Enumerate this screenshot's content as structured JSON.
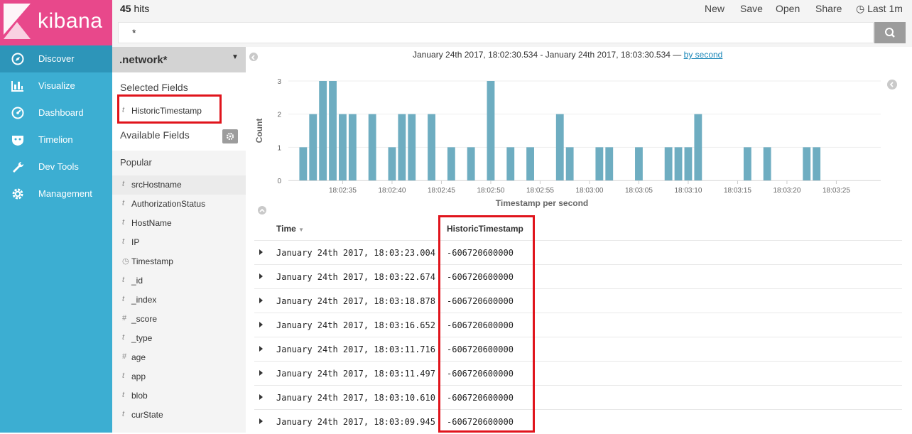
{
  "app": {
    "logo_text": "kibana",
    "brand_color": "#e8488b",
    "nav_color": "#3caed2"
  },
  "nav": {
    "items": [
      {
        "label": "Discover",
        "icon": "compass-icon",
        "active": true
      },
      {
        "label": "Visualize",
        "icon": "bar-chart-icon",
        "active": false
      },
      {
        "label": "Dashboard",
        "icon": "dashboard-gauge-icon",
        "active": false
      },
      {
        "label": "Timelion",
        "icon": "timelion-shield-icon",
        "active": false
      },
      {
        "label": "Dev Tools",
        "icon": "wrench-icon",
        "active": false
      },
      {
        "label": "Management",
        "icon": "gear-icon",
        "active": false
      }
    ]
  },
  "topbar": {
    "hits_count": "45",
    "hits_label": "hits",
    "actions": [
      "New",
      "Save",
      "Open",
      "Share"
    ],
    "time_picker": "Last 1m",
    "query": "*"
  },
  "sidebar": {
    "index_pattern": ".network*",
    "selected_title": "Selected Fields",
    "selected_fields": [
      {
        "type": "t",
        "name": "HistoricTimestamp"
      }
    ],
    "available_title": "Available Fields",
    "popular_title": "Popular",
    "popular_fields": [
      {
        "type": "t",
        "name": "srcHostname"
      }
    ],
    "fields": [
      {
        "type": "t",
        "name": "AuthorizationStatus"
      },
      {
        "type": "t",
        "name": "HostName"
      },
      {
        "type": "t",
        "name": "IP"
      },
      {
        "type": "clock",
        "name": "Timestamp"
      },
      {
        "type": "t",
        "name": "_id"
      },
      {
        "type": "t",
        "name": "_index"
      },
      {
        "type": "#",
        "name": "_score"
      },
      {
        "type": "t",
        "name": "_type"
      },
      {
        "type": "#",
        "name": "age"
      },
      {
        "type": "t",
        "name": "app"
      },
      {
        "type": "t",
        "name": "blob"
      },
      {
        "type": "t",
        "name": "curState"
      }
    ]
  },
  "histogram": {
    "range_text": "January 24th 2017, 18:02:30.534 - January 24th 2017, 18:03:30.534 —",
    "interval_link": "by second"
  },
  "chart_data": {
    "type": "bar",
    "xlabel": "Timestamp per second",
    "ylabel": "Count",
    "ylim": [
      0,
      3
    ],
    "yticks": [
      0,
      1,
      2,
      3
    ],
    "xticks": [
      "18:02:35",
      "18:02:40",
      "18:02:45",
      "18:02:50",
      "18:02:55",
      "18:03:00",
      "18:03:05",
      "18:03:10",
      "18:03:15",
      "18:03:20",
      "18:03:25"
    ],
    "x_start_second": 30,
    "x_end_second": 89,
    "bar_color": "#6eadc1",
    "bars": [
      {
        "x": "18:02:31",
        "value": 1
      },
      {
        "x": "18:02:32",
        "value": 2
      },
      {
        "x": "18:02:33",
        "value": 3
      },
      {
        "x": "18:02:34",
        "value": 3
      },
      {
        "x": "18:02:35",
        "value": 2
      },
      {
        "x": "18:02:36",
        "value": 2
      },
      {
        "x": "18:02:38",
        "value": 2
      },
      {
        "x": "18:02:40",
        "value": 1
      },
      {
        "x": "18:02:41",
        "value": 2
      },
      {
        "x": "18:02:42",
        "value": 2
      },
      {
        "x": "18:02:44",
        "value": 2
      },
      {
        "x": "18:02:46",
        "value": 1
      },
      {
        "x": "18:02:48",
        "value": 1
      },
      {
        "x": "18:02:50",
        "value": 3
      },
      {
        "x": "18:02:52",
        "value": 1
      },
      {
        "x": "18:02:54",
        "value": 1
      },
      {
        "x": "18:02:57",
        "value": 2
      },
      {
        "x": "18:02:58",
        "value": 1
      },
      {
        "x": "18:03:01",
        "value": 1
      },
      {
        "x": "18:03:02",
        "value": 1
      },
      {
        "x": "18:03:05",
        "value": 1
      },
      {
        "x": "18:03:08",
        "value": 1
      },
      {
        "x": "18:03:09",
        "value": 1
      },
      {
        "x": "18:03:10",
        "value": 1
      },
      {
        "x": "18:03:11",
        "value": 2
      },
      {
        "x": "18:03:16",
        "value": 1
      },
      {
        "x": "18:03:18",
        "value": 1
      },
      {
        "x": "18:03:22",
        "value": 1
      },
      {
        "x": "18:03:23",
        "value": 1
      }
    ]
  },
  "table": {
    "columns": [
      "Time",
      "HistoricTimestamp"
    ],
    "rows": [
      {
        "time": "January 24th 2017, 18:03:23.004",
        "historic": "-606720600000"
      },
      {
        "time": "January 24th 2017, 18:03:22.674",
        "historic": "-606720600000"
      },
      {
        "time": "January 24th 2017, 18:03:18.878",
        "historic": "-606720600000"
      },
      {
        "time": "January 24th 2017, 18:03:16.652",
        "historic": "-606720600000"
      },
      {
        "time": "January 24th 2017, 18:03:11.716",
        "historic": "-606720600000"
      },
      {
        "time": "January 24th 2017, 18:03:11.497",
        "historic": "-606720600000"
      },
      {
        "time": "January 24th 2017, 18:03:10.610",
        "historic": "-606720600000"
      },
      {
        "time": "January 24th 2017, 18:03:09.945",
        "historic": "-606720600000"
      }
    ]
  },
  "highlight_color": "#e0141c"
}
